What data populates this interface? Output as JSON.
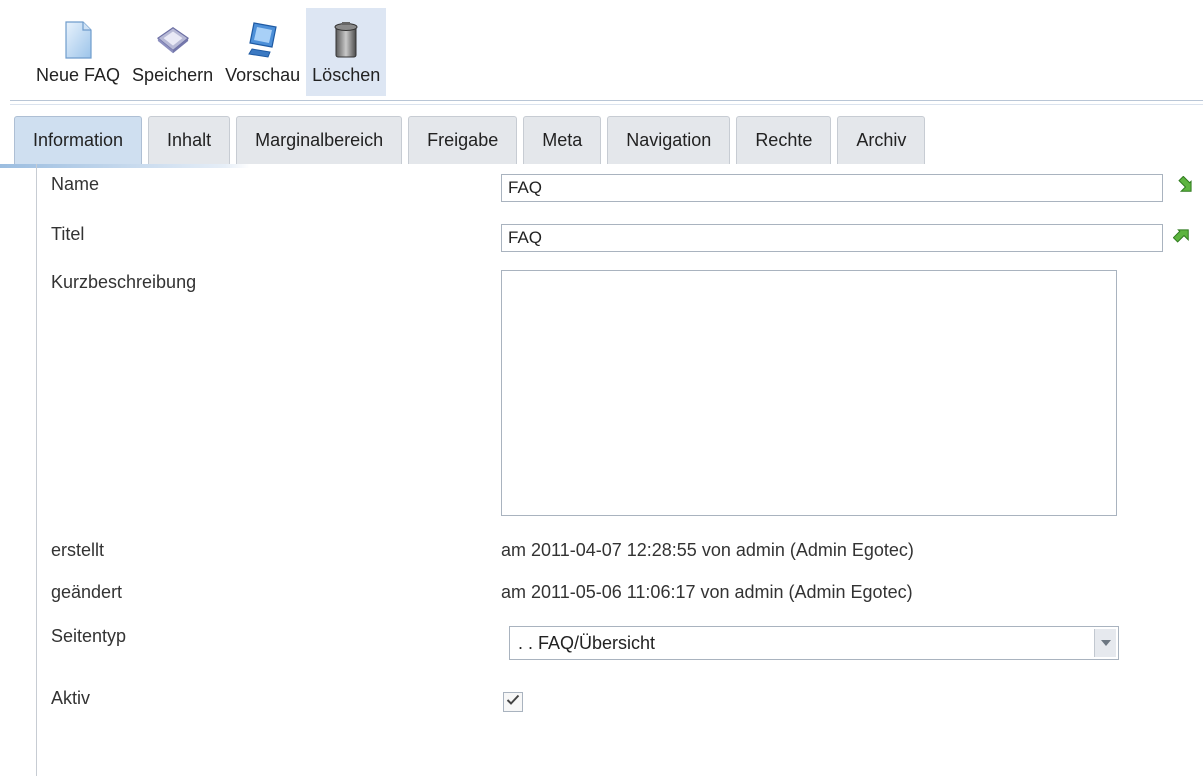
{
  "toolbar": {
    "new_label": "Neue FAQ",
    "save_label": "Speichern",
    "preview_label": "Vorschau",
    "delete_label": "Löschen"
  },
  "tabs": [
    {
      "label": "Information",
      "active": true
    },
    {
      "label": "Inhalt"
    },
    {
      "label": "Marginalbereich"
    },
    {
      "label": "Freigabe"
    },
    {
      "label": "Meta"
    },
    {
      "label": "Navigation"
    },
    {
      "label": "Rechte"
    },
    {
      "label": "Archiv"
    }
  ],
  "form": {
    "name_label": "Name",
    "name_value": "FAQ",
    "title_label": "Titel",
    "title_value": "FAQ",
    "description_label": "Kurzbeschreibung",
    "description_value": "",
    "created_label": "erstellt",
    "created_value": "am 2011-04-07 12:28:55 von admin (Admin Egotec)",
    "changed_label": "geändert",
    "changed_value": "am 2011-05-06 11:06:17 von admin (Admin Egotec)",
    "pagetype_label": "Seitentyp",
    "pagetype_value": ". . FAQ/Übersicht",
    "active_label": "Aktiv",
    "active_checked": true
  },
  "icons": {
    "new": "new-document-icon",
    "save": "save-diskette-icon",
    "preview": "monitor-icon",
    "delete": "trash-can-icon",
    "name_side": "arrow-down-green-icon",
    "title_side": "arrow-up-green-icon",
    "select_arrow": "chevron-down-icon",
    "checkbox": "checkmark-icon"
  },
  "colors": {
    "accent": "#cfdff0",
    "toolbar_active": "#dde6f3",
    "green_icon": "#3a9a2a"
  }
}
